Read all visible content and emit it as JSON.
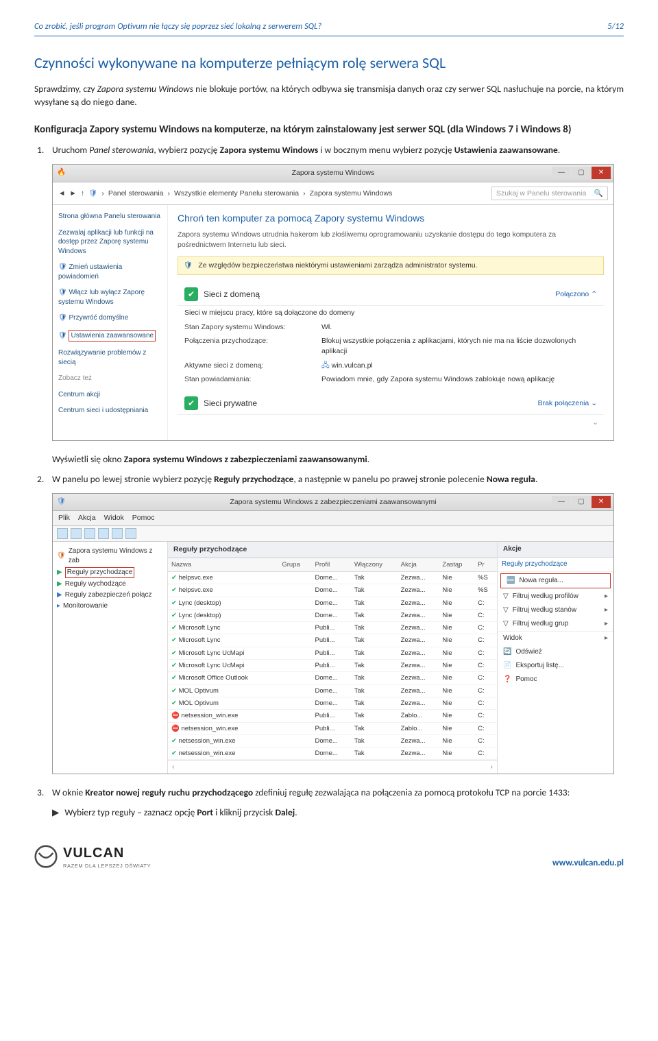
{
  "header": {
    "title": "Co zrobić, jeśli program Optivum nie łączy się poprzez sieć lokalną z serwerem SQL?",
    "page": "5/12"
  },
  "h1": "Czynności wykonywane na komputerze pełniącym rolę serwera SQL",
  "intro": {
    "p1a": "Sprawdzimy, czy ",
    "p1b": "Zapora systemu Windows",
    "p1c": " nie blokuje portów, na których odbywa się transmisja danych oraz czy serwer SQL nasłuchuje na porcie, na którym wysyłane są do niego dane."
  },
  "h2": "Konfiguracja Zapory systemu Windows na komputerze, na którym zainstalowany jest serwer SQL (dla Windows 7 i Windows 8)",
  "step1": {
    "a": "Uruchom ",
    "b": "Panel sterowania",
    "c": ", wybierz pozycję ",
    "d": "Zapora systemu Windows",
    "e": " i w bocznym menu wybierz pozycję ",
    "f": "Ustawienia zaawansowane",
    "g": "."
  },
  "shot1": {
    "title": "Zapora systemu Windows",
    "crumb": {
      "c1": "Panel sterowania",
      "c2": "Wszystkie elementy Panelu sterowania",
      "c3": "Zapora systemu Windows",
      "search": "Szukaj w Panelu sterowania"
    },
    "side": {
      "i1": "Strona główna Panelu sterowania",
      "i2": "Zezwalaj aplikacji lub funkcji na dostęp przez Zaporę systemu Windows",
      "i3": "Zmień ustawienia powiadomień",
      "i4": "Włącz lub wyłącz Zaporę systemu Windows",
      "i5": "Przywróć domyślne",
      "i6": "Ustawienia zaawansowane",
      "i7": "Rozwiązywanie problemów z siecią",
      "see": "Zobacz też",
      "s1": "Centrum akcji",
      "s2": "Centrum sieci i udostępniania"
    },
    "main": {
      "h": "Chroń ten komputer za pomocą Zapory systemu Windows",
      "sub": "Zapora systemu Windows utrudnia hakerom lub złośliwemu oprogramowaniu uzyskanie dostępu do tego komputera za pośrednictwem Internetu lub sieci.",
      "info": "Ze względów bezpieczeństwa niektórymi ustawieniami zarządza administrator systemu.",
      "row1": "Sieci z domeną",
      "row1s": "Połączono",
      "row1d": "Sieci w miejscu pracy, które są dołączone do domeny",
      "kv1k": "Stan Zapory systemu Windows:",
      "kv1v": "Wł.",
      "kv2k": "Połączenia przychodzące:",
      "kv2v": "Blokuj wszystkie połączenia z aplikacjami, których nie ma na liście dozwolonych aplikacji",
      "kv3k": "Aktywne sieci z domeną:",
      "kv3v": "win.vulcan.pl",
      "kv4k": "Stan powiadamiania:",
      "kv4v": "Powiadom mnie, gdy Zapora systemu Windows zablokuje nową aplikację",
      "row2": "Sieci prywatne",
      "row2s": "Brak połączenia"
    }
  },
  "after1": "Wyświetli się okno ",
  "after1b": "Zapora systemu Windows z zabezpieczeniami zaawansowanymi",
  "after1c": ".",
  "step2": {
    "a": "W panelu po lewej stronie wybierz pozycję ",
    "b": "Reguły przychodzące",
    "c": ", a następnie w panelu po prawej stronie polecenie ",
    "d": "Nowa reguła",
    "e": "."
  },
  "shot2": {
    "title": "Zapora systemu Windows z zabezpieczeniami zaawansowanymi",
    "menu": {
      "m1": "Plik",
      "m2": "Akcja",
      "m3": "Widok",
      "m4": "Pomoc"
    },
    "tree": {
      "t1": "Zapora systemu Windows z zab",
      "t2": "Reguły przychodzące",
      "t3": "Reguły wychodzące",
      "t4": "Reguły zabezpieczeń połącz",
      "t5": "Monitorowanie"
    },
    "centerTitle": "Reguły przychodzące",
    "cols": {
      "c1": "Nazwa",
      "c2": "Grupa",
      "c3": "Profil",
      "c4": "Włączony",
      "c5": "Akcja",
      "c6": "Zastąp",
      "c7": "Pr"
    },
    "rows": [
      {
        "ok": true,
        "n": "helpsvc.exe",
        "p": "Dome...",
        "w": "Tak",
        "a": "Zezwa...",
        "z": "Nie",
        "pr": "%S"
      },
      {
        "ok": true,
        "n": "helpsvc.exe",
        "p": "Dome...",
        "w": "Tak",
        "a": "Zezwa...",
        "z": "Nie",
        "pr": "%S"
      },
      {
        "ok": true,
        "n": "Lync (desktop)",
        "p": "Dome...",
        "w": "Tak",
        "a": "Zezwa...",
        "z": "Nie",
        "pr": "C:"
      },
      {
        "ok": true,
        "n": "Lync (desktop)",
        "p": "Dome...",
        "w": "Tak",
        "a": "Zezwa...",
        "z": "Nie",
        "pr": "C:"
      },
      {
        "ok": true,
        "n": "Microsoft Lync",
        "p": "Publi...",
        "w": "Tak",
        "a": "Zezwa...",
        "z": "Nie",
        "pr": "C:"
      },
      {
        "ok": true,
        "n": "Microsoft Lync",
        "p": "Publi...",
        "w": "Tak",
        "a": "Zezwa...",
        "z": "Nie",
        "pr": "C:"
      },
      {
        "ok": true,
        "n": "Microsoft Lync UcMapi",
        "p": "Publi...",
        "w": "Tak",
        "a": "Zezwa...",
        "z": "Nie",
        "pr": "C:"
      },
      {
        "ok": true,
        "n": "Microsoft Lync UcMapi",
        "p": "Publi...",
        "w": "Tak",
        "a": "Zezwa...",
        "z": "Nie",
        "pr": "C:"
      },
      {
        "ok": true,
        "n": "Microsoft Office Outlook",
        "p": "Dome...",
        "w": "Tak",
        "a": "Zezwa...",
        "z": "Nie",
        "pr": "C:"
      },
      {
        "ok": true,
        "n": "MOL Optivum",
        "p": "Dome...",
        "w": "Tak",
        "a": "Zezwa...",
        "z": "Nie",
        "pr": "C:"
      },
      {
        "ok": true,
        "n": "MOL Optivum",
        "p": "Dome...",
        "w": "Tak",
        "a": "Zezwa...",
        "z": "Nie",
        "pr": "C:"
      },
      {
        "ok": false,
        "n": "netsession_win.exe",
        "p": "Publi...",
        "w": "Tak",
        "a": "Zablo...",
        "z": "Nie",
        "pr": "C:"
      },
      {
        "ok": false,
        "n": "netsession_win.exe",
        "p": "Publi...",
        "w": "Tak",
        "a": "Zablo...",
        "z": "Nie",
        "pr": "C:"
      },
      {
        "ok": true,
        "n": "netsession_win.exe",
        "p": "Dome...",
        "w": "Tak",
        "a": "Zezwa...",
        "z": "Nie",
        "pr": "C:"
      },
      {
        "ok": true,
        "n": "netsession_win.exe",
        "p": "Dome...",
        "w": "Tak",
        "a": "Zezwa...",
        "z": "Nie",
        "pr": "C:"
      }
    ],
    "right": {
      "title": "Akcje",
      "sect": "Reguły przychodzące",
      "r1": "Nowa reguła...",
      "r2": "Filtruj według profilów",
      "r3": "Filtruj według stanów",
      "r4": "Filtruj według grup",
      "r5": "Widok",
      "r6": "Odśwież",
      "r7": "Eksportuj listę...",
      "r8": "Pomoc"
    }
  },
  "step3": {
    "a": "W oknie ",
    "b": "Kreator nowej reguły ruchu przychodzącego",
    "c": " zdefiniuj regułę zezwalająca na połączenia za pomocą protokołu TCP na porcie 1433:",
    "bullet_a": "Wybierz typ reguły – zaznacz opcję ",
    "bullet_b": "Port",
    "bullet_c": " i kliknij przycisk ",
    "bullet_d": "Dalej",
    "bullet_e": "."
  },
  "footer": {
    "brand": "VULCAN",
    "tag": "RAZEM DLA LEPSZEJ OŚWIATY",
    "url": "www.vulcan.edu.pl"
  }
}
